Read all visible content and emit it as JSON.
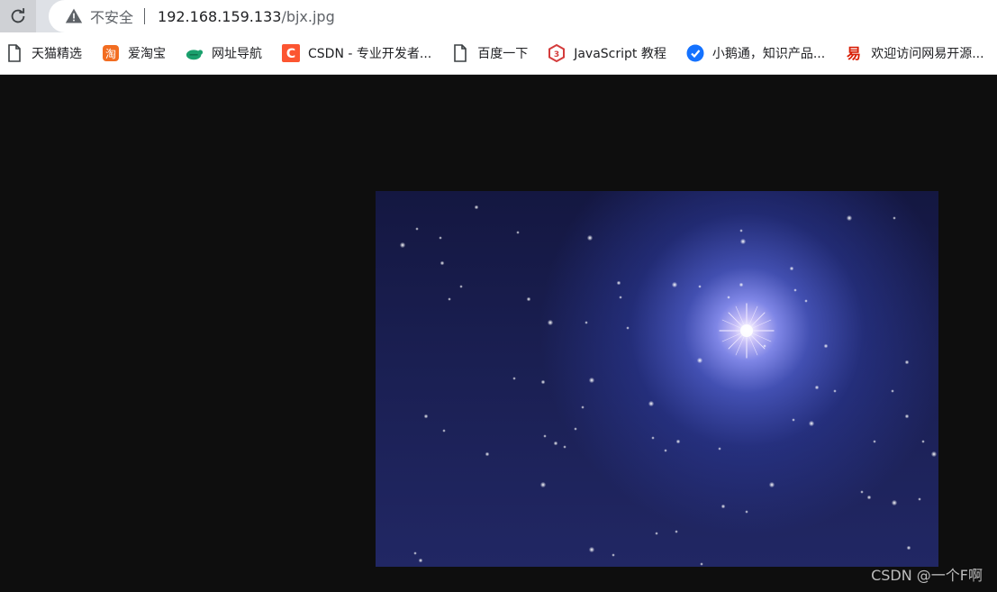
{
  "browser": {
    "security_label": "不安全",
    "url_host": "192.168.159.133",
    "url_path": "/bjx.jpg"
  },
  "bookmarks": [
    {
      "label": "天猫精选",
      "icon": "page-icon"
    },
    {
      "label": "爱淘宝",
      "icon": "taobao-icon"
    },
    {
      "label": "网址导航",
      "icon": "turtle-icon"
    },
    {
      "label": "CSDN - 专业开发者...",
      "icon": "csdn-icon"
    },
    {
      "label": "百度一下",
      "icon": "page-icon"
    },
    {
      "label": "JavaScript 教程",
      "icon": "runoob-icon"
    },
    {
      "label": "小鹅通，知识产品...",
      "icon": "xiaoe-icon"
    },
    {
      "label": "欢迎访问网易开源...",
      "icon": "netease-icon"
    }
  ],
  "watermark": "CSDN @一个F啊"
}
